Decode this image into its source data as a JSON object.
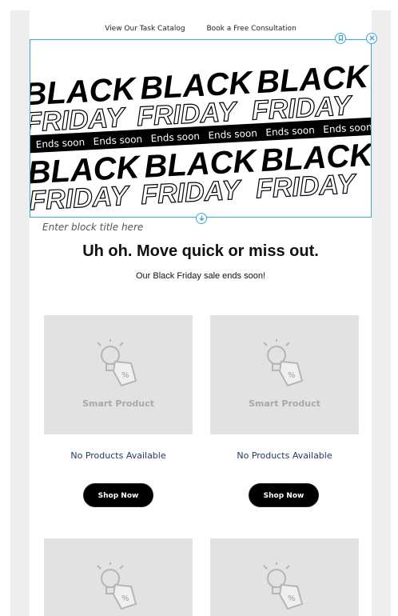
{
  "nav": {
    "catalog_link": "View Our Task Catalog",
    "consult_link": "Book a Free Consultation"
  },
  "banner": {
    "word1": "BLACK",
    "word2": "FRIDAY",
    "ticker": "Ends soon"
  },
  "block": {
    "title_placeholder": "Enter block title here"
  },
  "hero": {
    "headline": "Uh oh. Move quick or miss out.",
    "subline": "Our Black Friday sale ends soon!"
  },
  "products": {
    "placeholder_label": "Smart Product",
    "empty_text": "No Products Available",
    "button_label": "Shop Now"
  },
  "colors": {
    "accent": "#3ea6de",
    "placeholder_bg": "#e2e2e2",
    "button_bg": "#000000",
    "link_text": "#1f3a6b"
  },
  "icons": [
    "bookmark-icon",
    "close-icon",
    "arrow-down-circle-icon",
    "lightbulb-tag-icon"
  ]
}
